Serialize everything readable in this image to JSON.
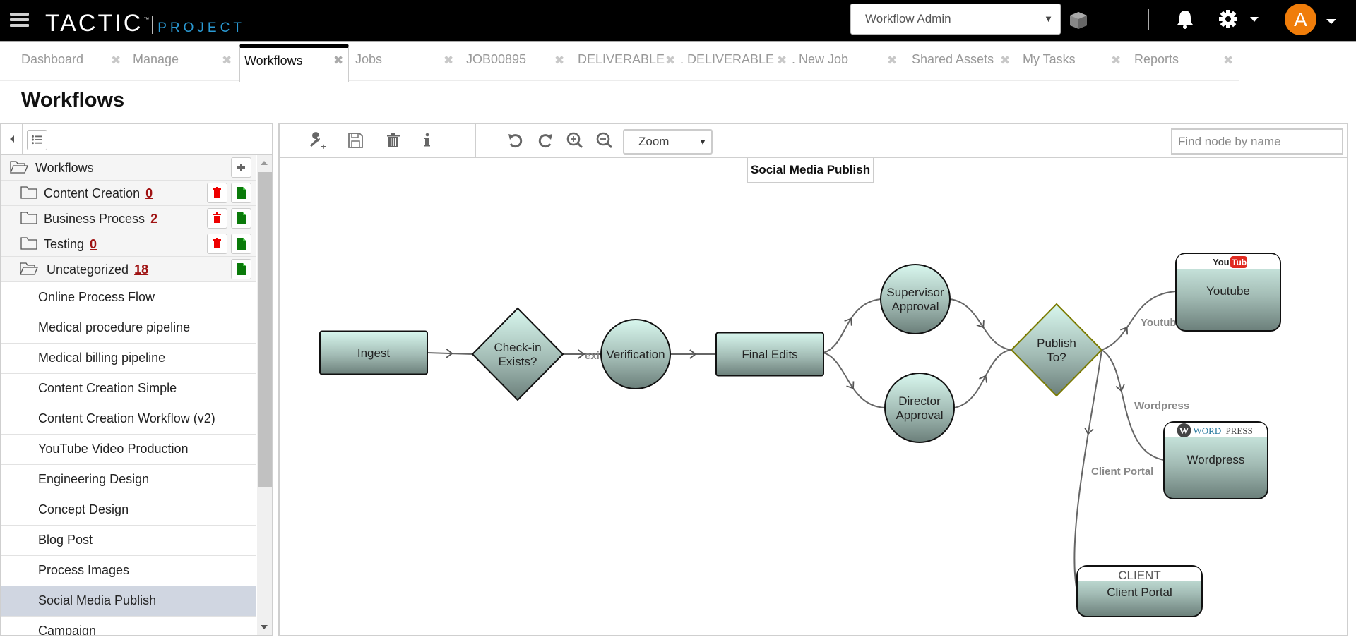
{
  "header": {
    "logo_main": "TACTIC",
    "logo_tm": "™",
    "logo_sub": "PROJECT",
    "project_select": "Workflow Admin",
    "avatar_initial": "A",
    "avatar_color": "#f07d0a",
    "accent_color": "#2a9ad4"
  },
  "tabs": [
    {
      "label": "Dashboard",
      "active": false
    },
    {
      "label": "Manage",
      "active": false
    },
    {
      "label": "Workflows",
      "active": true
    },
    {
      "label": "Jobs",
      "active": false
    },
    {
      "label": "JOB00895",
      "active": false
    },
    {
      "label": "DELIVERABLE",
      "active": false
    },
    {
      "label": ". DELIVERABLE",
      "active": false
    },
    {
      "label": ". New Job",
      "active": false
    },
    {
      "label": "Shared Assets",
      "active": false
    },
    {
      "label": "My Tasks",
      "active": false
    },
    {
      "label": "Reports",
      "active": false
    }
  ],
  "page": {
    "title": "Workflows"
  },
  "sidebar": {
    "root": {
      "label": "Workflows"
    },
    "folders": [
      {
        "label": "Content Creation",
        "count": "0"
      },
      {
        "label": "Business Process",
        "count": "2"
      },
      {
        "label": "Testing",
        "count": "0"
      },
      {
        "label": "Uncategorized",
        "count": "18"
      }
    ],
    "items": [
      {
        "label": "Online Process Flow",
        "selected": false
      },
      {
        "label": "Medical procedure pipeline",
        "selected": false
      },
      {
        "label": "Medical billing pipeline",
        "selected": false
      },
      {
        "label": "Content Creation Simple",
        "selected": false
      },
      {
        "label": "Content Creation Workflow (v2)",
        "selected": false
      },
      {
        "label": "YouTube Video Production",
        "selected": false
      },
      {
        "label": "Engineering Design",
        "selected": false
      },
      {
        "label": "Concept Design",
        "selected": false
      },
      {
        "label": "Blog Post",
        "selected": false
      },
      {
        "label": "Process Images",
        "selected": false
      },
      {
        "label": "Social Media Publish",
        "selected": true
      },
      {
        "label": "Campaign",
        "selected": false
      }
    ]
  },
  "toolbar": {
    "zoom_label": "Zoom",
    "find_placeholder": "Find node by name"
  },
  "diagram": {
    "title": "Social Media Publish",
    "nodes": [
      {
        "id": "ingest",
        "label": [
          "Ingest"
        ],
        "shape": "rect"
      },
      {
        "id": "checkin",
        "label": [
          "Check-in",
          "Exists?"
        ],
        "shape": "diamond"
      },
      {
        "id": "verification",
        "label": [
          "Verification"
        ],
        "shape": "circle"
      },
      {
        "id": "final_edits",
        "label": [
          "Final Edits"
        ],
        "shape": "rect"
      },
      {
        "id": "supervisor",
        "label": [
          "Supervisor",
          "Approval"
        ],
        "shape": "circle"
      },
      {
        "id": "director",
        "label": [
          "Director",
          "Approval"
        ],
        "shape": "circle"
      },
      {
        "id": "publish",
        "label": [
          "Publish",
          "To?"
        ],
        "shape": "diamond"
      },
      {
        "id": "youtube",
        "label": [
          "Youtube"
        ],
        "shape": "output",
        "banner": "YouTube"
      },
      {
        "id": "wordpress",
        "label": [
          "Wordpress"
        ],
        "shape": "output",
        "banner": "WordPress"
      },
      {
        "id": "client_portal",
        "label": [
          "Client Portal"
        ],
        "shape": "output",
        "banner": "CLIENT"
      }
    ],
    "edges": [
      {
        "from": "ingest",
        "to": "checkin",
        "label": ""
      },
      {
        "from": "checkin",
        "to": "verification",
        "label": "exi"
      },
      {
        "from": "verification",
        "to": "final_edits",
        "label": ""
      },
      {
        "from": "final_edits",
        "to": "supervisor",
        "label": ""
      },
      {
        "from": "final_edits",
        "to": "director",
        "label": ""
      },
      {
        "from": "supervisor",
        "to": "publish",
        "label": ""
      },
      {
        "from": "director",
        "to": "publish",
        "label": ""
      },
      {
        "from": "publish",
        "to": "youtube",
        "label": "Youtub"
      },
      {
        "from": "publish",
        "to": "wordpress",
        "label": "Wordpress"
      },
      {
        "from": "publish",
        "to": "client_portal",
        "label": "Client Portal"
      }
    ]
  }
}
